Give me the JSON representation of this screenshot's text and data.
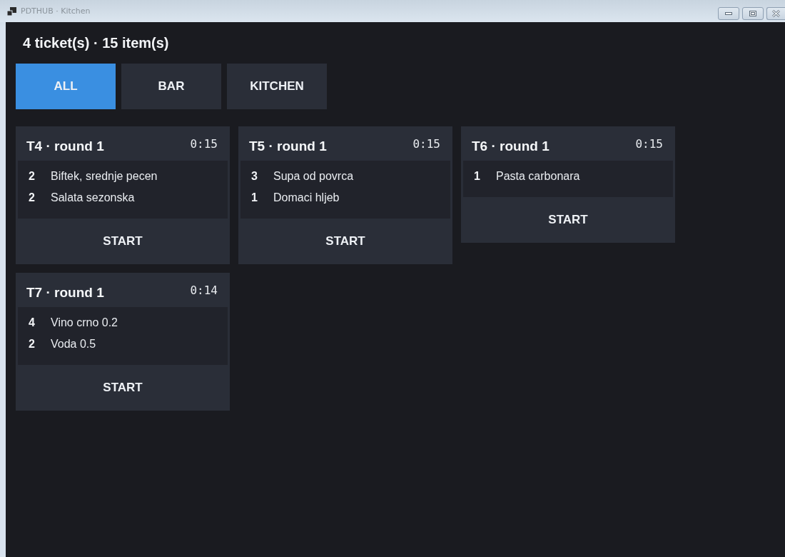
{
  "window": {
    "title": "PDTHUB · Kitchen"
  },
  "summary": "4 ticket(s) · 15 item(s)",
  "tabs": [
    {
      "label": "ALL",
      "selected": true
    },
    {
      "label": "BAR",
      "selected": false
    },
    {
      "label": "KITCHEN",
      "selected": false
    }
  ],
  "tickets": [
    {
      "title": "T4 · round 1",
      "timer": "0:15",
      "items": [
        {
          "qty": "2",
          "name": "Biftek, srednje pecen"
        },
        {
          "qty": "2",
          "name": "Salata sezonska"
        }
      ],
      "action": "START"
    },
    {
      "title": "T5 · round 1",
      "timer": "0:15",
      "items": [
        {
          "qty": "3",
          "name": "Supa od povrca"
        },
        {
          "qty": "1",
          "name": "Domaci hljeb"
        }
      ],
      "action": "START"
    },
    {
      "title": "T6 · round 1",
      "timer": "0:15",
      "items": [
        {
          "qty": "1",
          "name": "Pasta carbonara"
        }
      ],
      "action": "START"
    },
    {
      "title": "T7 · round 1",
      "timer": "0:14",
      "items": [
        {
          "qty": "4",
          "name": "Vino crno 0.2"
        },
        {
          "qty": "2",
          "name": "Voda 0.5"
        }
      ],
      "action": "START"
    }
  ]
}
